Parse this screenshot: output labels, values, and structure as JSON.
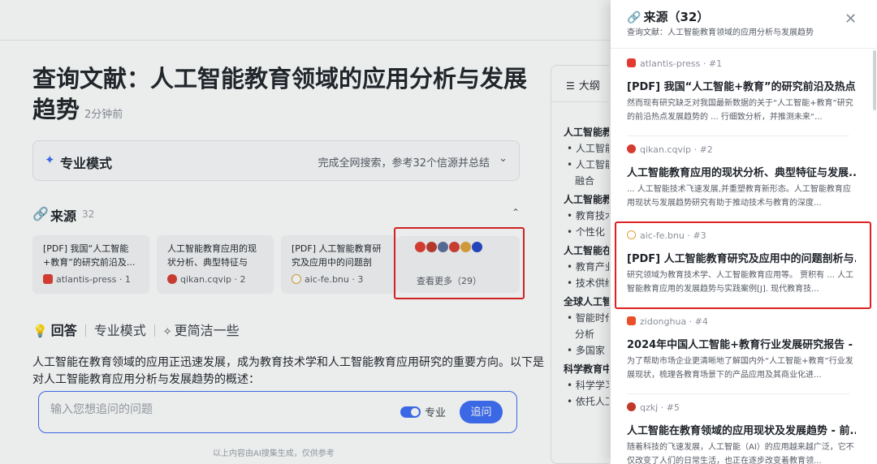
{
  "main": {
    "title": "查询文献：人工智能教育领域的应用分析与发展趋势",
    "time_ago": "2分钟前",
    "mode": {
      "label": "专业模式",
      "summary": "完成全网搜索，参考32个信源并总结"
    },
    "sources": {
      "label": "来源",
      "count": "32",
      "cards": [
        {
          "title": "[PDF] 我国“人工智能+教育”的研究前沿及...",
          "site": "atlantis-press · 1",
          "color": "#e23a2e"
        },
        {
          "title": "人工智能教育应用的现状分析、典型特征与发...",
          "site": "qikan.cqvip · 2",
          "color": "#d63b2f"
        },
        {
          "title": "[PDF] 人工智能教育研究及应用中的问题剖析...",
          "site": "aic-fe.bnu · 3",
          "color": "#e0a23a"
        }
      ],
      "more": {
        "icon_colors": [
          "#e23a2e",
          "#c0392b",
          "#5a6e9c",
          "#d63b2f",
          "#e0a23a",
          "#2345c8"
        ],
        "label": "查看更多（29）"
      }
    },
    "answer": {
      "label": "回答",
      "options": [
        "专业模式",
        "更简洁一些"
      ],
      "body": "人工智能在教育领域的应用正迅速发展，成为教育技术学和人工智能教育应用研究的重要方向。以下是对人工智能教育应用分析与发展趋势的概述："
    },
    "composer": {
      "placeholder": "输入您想追问的问题",
      "toggle_label": "专业",
      "ask_button": "追问"
    },
    "footer_note": "以上内容由AI搜集生成，仅供参考"
  },
  "outline": {
    "header": "大纲",
    "items": [
      {
        "kind": "sec",
        "text": "人工智能教"
      },
      {
        "kind": "it",
        "text": "• 人工智能"
      },
      {
        "kind": "it",
        "text": "• 人工智能"
      },
      {
        "kind": "it2",
        "text": "融合"
      },
      {
        "kind": "sec",
        "text": "人工智能教"
      },
      {
        "kind": "it",
        "text": "• 教育技术"
      },
      {
        "kind": "it",
        "text": "• 个性化"
      },
      {
        "kind": "sec",
        "text": "人工智能在"
      },
      {
        "kind": "it",
        "text": "• 教育产业"
      },
      {
        "kind": "it",
        "text": "• 技术供给"
      },
      {
        "kind": "sec",
        "text": "全球人工智"
      },
      {
        "kind": "it",
        "text": "• 智能时代"
      },
      {
        "kind": "it2",
        "text": "分析"
      },
      {
        "kind": "it",
        "text": "• 多国家"
      },
      {
        "kind": "sec",
        "text": "科学教育中"
      },
      {
        "kind": "it",
        "text": "• 科学学习"
      },
      {
        "kind": "it",
        "text": "• 依托人工"
      }
    ]
  },
  "drawer": {
    "title": "来源（32）",
    "subtitle": "查询文献：人工智能教育领域的应用分析与发展趋势",
    "refs": [
      {
        "site": "atlantis-press · #1",
        "color": "#e23a2e",
        "title": "[PDF] 我国“人工智能+教育”的研究前沿及热点分...",
        "snippet": "然而现有研究缺乏对我国最新数据的关于“人工智能+教育”研究的前沿热点发展趋势的 ... 行细致分析，并推测未来“..."
      },
      {
        "site": "qikan.cqvip · #2",
        "color": "#d63b2f",
        "title": "人工智能教育应用的现状分析、典型特征与发展...",
        "snippet": "... 人工智能技术飞速发展,并重塑教育新形态。人工智能教育应用现状与发展趋势研究有助于推动技术与教育的深度..."
      },
      {
        "site": "aic-fe.bnu · #3",
        "color": "#e0a23a",
        "title": "[PDF] 人工智能教育研究及应用中的问题剖析与...",
        "snippet": "研究领域为教育技术学、人工智能教育应用等。 贾积有 ... 人工智能教育应用的发展趋势与实践案例[J]. 现代教育技..."
      },
      {
        "site": "zidonghua · #4",
        "color": "#e8502a",
        "title": "2024年中国人工智能+教育行业发展研究报告 - ...",
        "snippet": "为了帮助市场企业更清晰地了解国内外“人工智能+教育”行业发展现状，梳理各教育场景下的产品应用及其商业化进..."
      },
      {
        "site": "qzkj · #5",
        "color": "#c0392b",
        "title": "人工智能在教育领域的应用现状及发展趋势 - 前...",
        "snippet": "随着科技的飞速发展，人工智能（AI）的应用越来越广泛，它不仅改变了人们的日常生活，也正在逐步改变着教育领..."
      }
    ]
  }
}
